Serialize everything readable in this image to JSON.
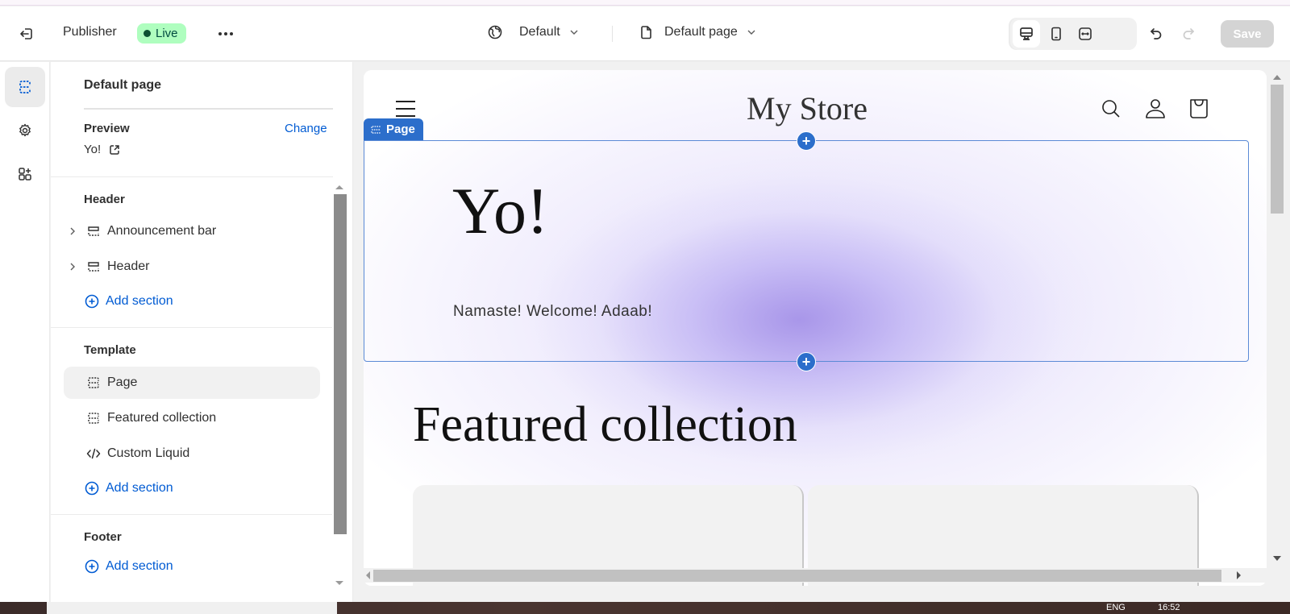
{
  "topbar": {
    "exit_icon": "exit-icon",
    "app_name": "Publisher",
    "status_badge": "Live",
    "more_icon": "ellipsis-icon",
    "theme_selector": {
      "icon": "globe-icon",
      "label": "Default"
    },
    "page_selector": {
      "icon": "page-icon",
      "label": "Default page"
    },
    "tools": [
      {
        "name": "inspector-icon",
        "active": true
      },
      {
        "name": "desktop-icon",
        "active": true
      },
      {
        "name": "mobile-icon",
        "active": false
      },
      {
        "name": "full-width-icon",
        "active": false
      }
    ],
    "undo_icon": "undo-icon",
    "redo_icon": "redo-icon",
    "save_label": "Save"
  },
  "rail": {
    "items": [
      {
        "name": "sections-icon",
        "active": true
      },
      {
        "name": "settings-icon",
        "active": false
      },
      {
        "name": "apps-icon",
        "active": false
      }
    ]
  },
  "panel": {
    "title": "Default page",
    "preview_label": "Preview",
    "change_label": "Change",
    "preview_value": "Yo!",
    "groups": {
      "header": {
        "title": "Header",
        "items": [
          {
            "label": "Announcement bar",
            "icon": "section-icon",
            "expandable": true
          },
          {
            "label": "Header",
            "icon": "section-icon",
            "expandable": true
          }
        ],
        "add_label": "Add section"
      },
      "template": {
        "title": "Template",
        "items": [
          {
            "label": "Page",
            "icon": "section-icon",
            "selected": true
          },
          {
            "label": "Featured collection",
            "icon": "section-icon",
            "selected": false
          },
          {
            "label": "Custom Liquid",
            "icon": "code-icon",
            "selected": false
          }
        ],
        "add_label": "Add section"
      },
      "footer": {
        "title": "Footer",
        "add_label": "Add section"
      }
    }
  },
  "preview": {
    "store_name": "My Store",
    "page_tag": "Page",
    "hero_title": "Yo!",
    "hero_text": "Namaste! Welcome! Adaab!",
    "featured_title": "Featured collection"
  },
  "taskbar": {
    "language": "ENG",
    "time": "16:52"
  },
  "colors": {
    "accent": "#005bd3",
    "selection": "#2c6ecb",
    "live_badge": "#affebf"
  }
}
